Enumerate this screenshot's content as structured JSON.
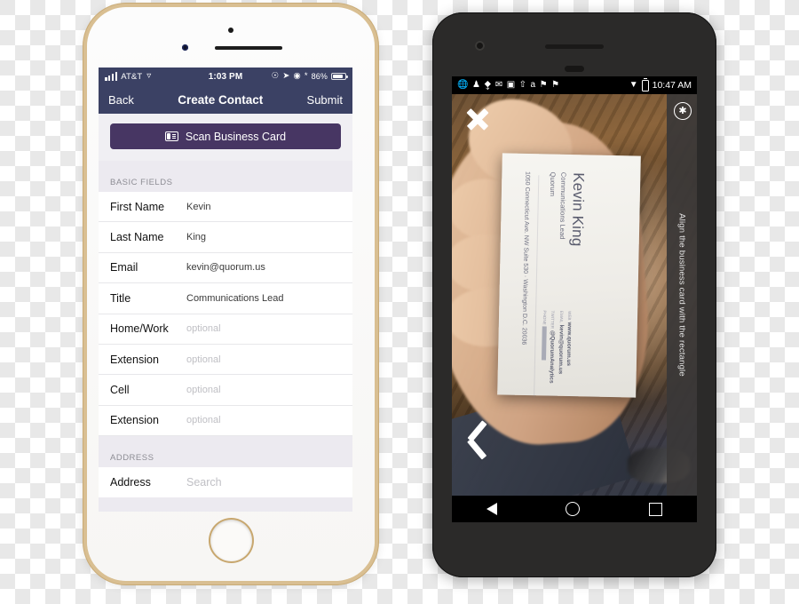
{
  "iphone": {
    "status": {
      "carrier": "AT&T",
      "time": "1:03 PM",
      "battery_percent": "86%",
      "icons": [
        "signal-bars-icon",
        "wifi-icon",
        "alarm-icon",
        "location-arrow-icon",
        "rotation-lock-icon",
        "bluetooth-icon",
        "battery-icon"
      ]
    },
    "nav": {
      "back_label": "Back",
      "title": "Create Contact",
      "submit_label": "Submit"
    },
    "scan_button": {
      "label": "Scan Business Card",
      "icon": "contact-card-icon",
      "color": "#473663"
    },
    "sections": [
      {
        "header": "BASIC FIELDS",
        "fields": [
          {
            "label": "First Name",
            "value": "Kevin",
            "placeholder": ""
          },
          {
            "label": "Last Name",
            "value": "King",
            "placeholder": ""
          },
          {
            "label": "Email",
            "value": "kevin@quorum.us",
            "placeholder": ""
          },
          {
            "label": "Title",
            "value": "Communications Lead",
            "placeholder": ""
          },
          {
            "label": "Home/Work",
            "value": "",
            "placeholder": "optional"
          },
          {
            "label": "Extension",
            "value": "",
            "placeholder": "optional"
          },
          {
            "label": "Cell",
            "value": "",
            "placeholder": "optional"
          },
          {
            "label": "Extension",
            "value": "",
            "placeholder": "optional"
          }
        ]
      },
      {
        "header": "ADDRESS",
        "fields": [
          {
            "label": "Address",
            "value": "",
            "placeholder": "Search"
          }
        ]
      }
    ],
    "theme": {
      "navbar": "#3b4164",
      "group_bg": "#eceaf0"
    }
  },
  "android": {
    "status": {
      "time": "10:47 AM",
      "notification_icons": [
        "browser-icon",
        "contact-icon",
        "shield-icon",
        "gmail-icon",
        "screenshot-icon",
        "upload-icon",
        "amazon-icon",
        "flag-icon",
        "flag-icon"
      ],
      "right_icons": [
        "wifi-icon",
        "battery-icon"
      ]
    },
    "camera": {
      "close_label": "×",
      "close_icon": "close-icon",
      "back_icon": "chevron-left-icon",
      "flash_icon": "flash-off-icon",
      "hint": "Align the business card with the rectangle"
    },
    "business_card": {
      "name": "Kevin King",
      "title": "Communications Lead",
      "org": "Quorum",
      "address": "1050 Connecticut Ave. NW Suite 530 · Washington D.C. 20036",
      "contacts": [
        {
          "label": "WEB",
          "value": "www.quorum.us"
        },
        {
          "label": "EMAIL",
          "value": "kevin@quorum.us"
        },
        {
          "label": "TWITTER",
          "value": "@QuorumAnalytics"
        },
        {
          "label": "PHONE",
          "value": ""
        }
      ]
    },
    "nav": {
      "back_icon": "nav-back-triangle-icon",
      "home_icon": "nav-home-circle-icon",
      "recents_icon": "nav-recents-square-icon"
    }
  }
}
